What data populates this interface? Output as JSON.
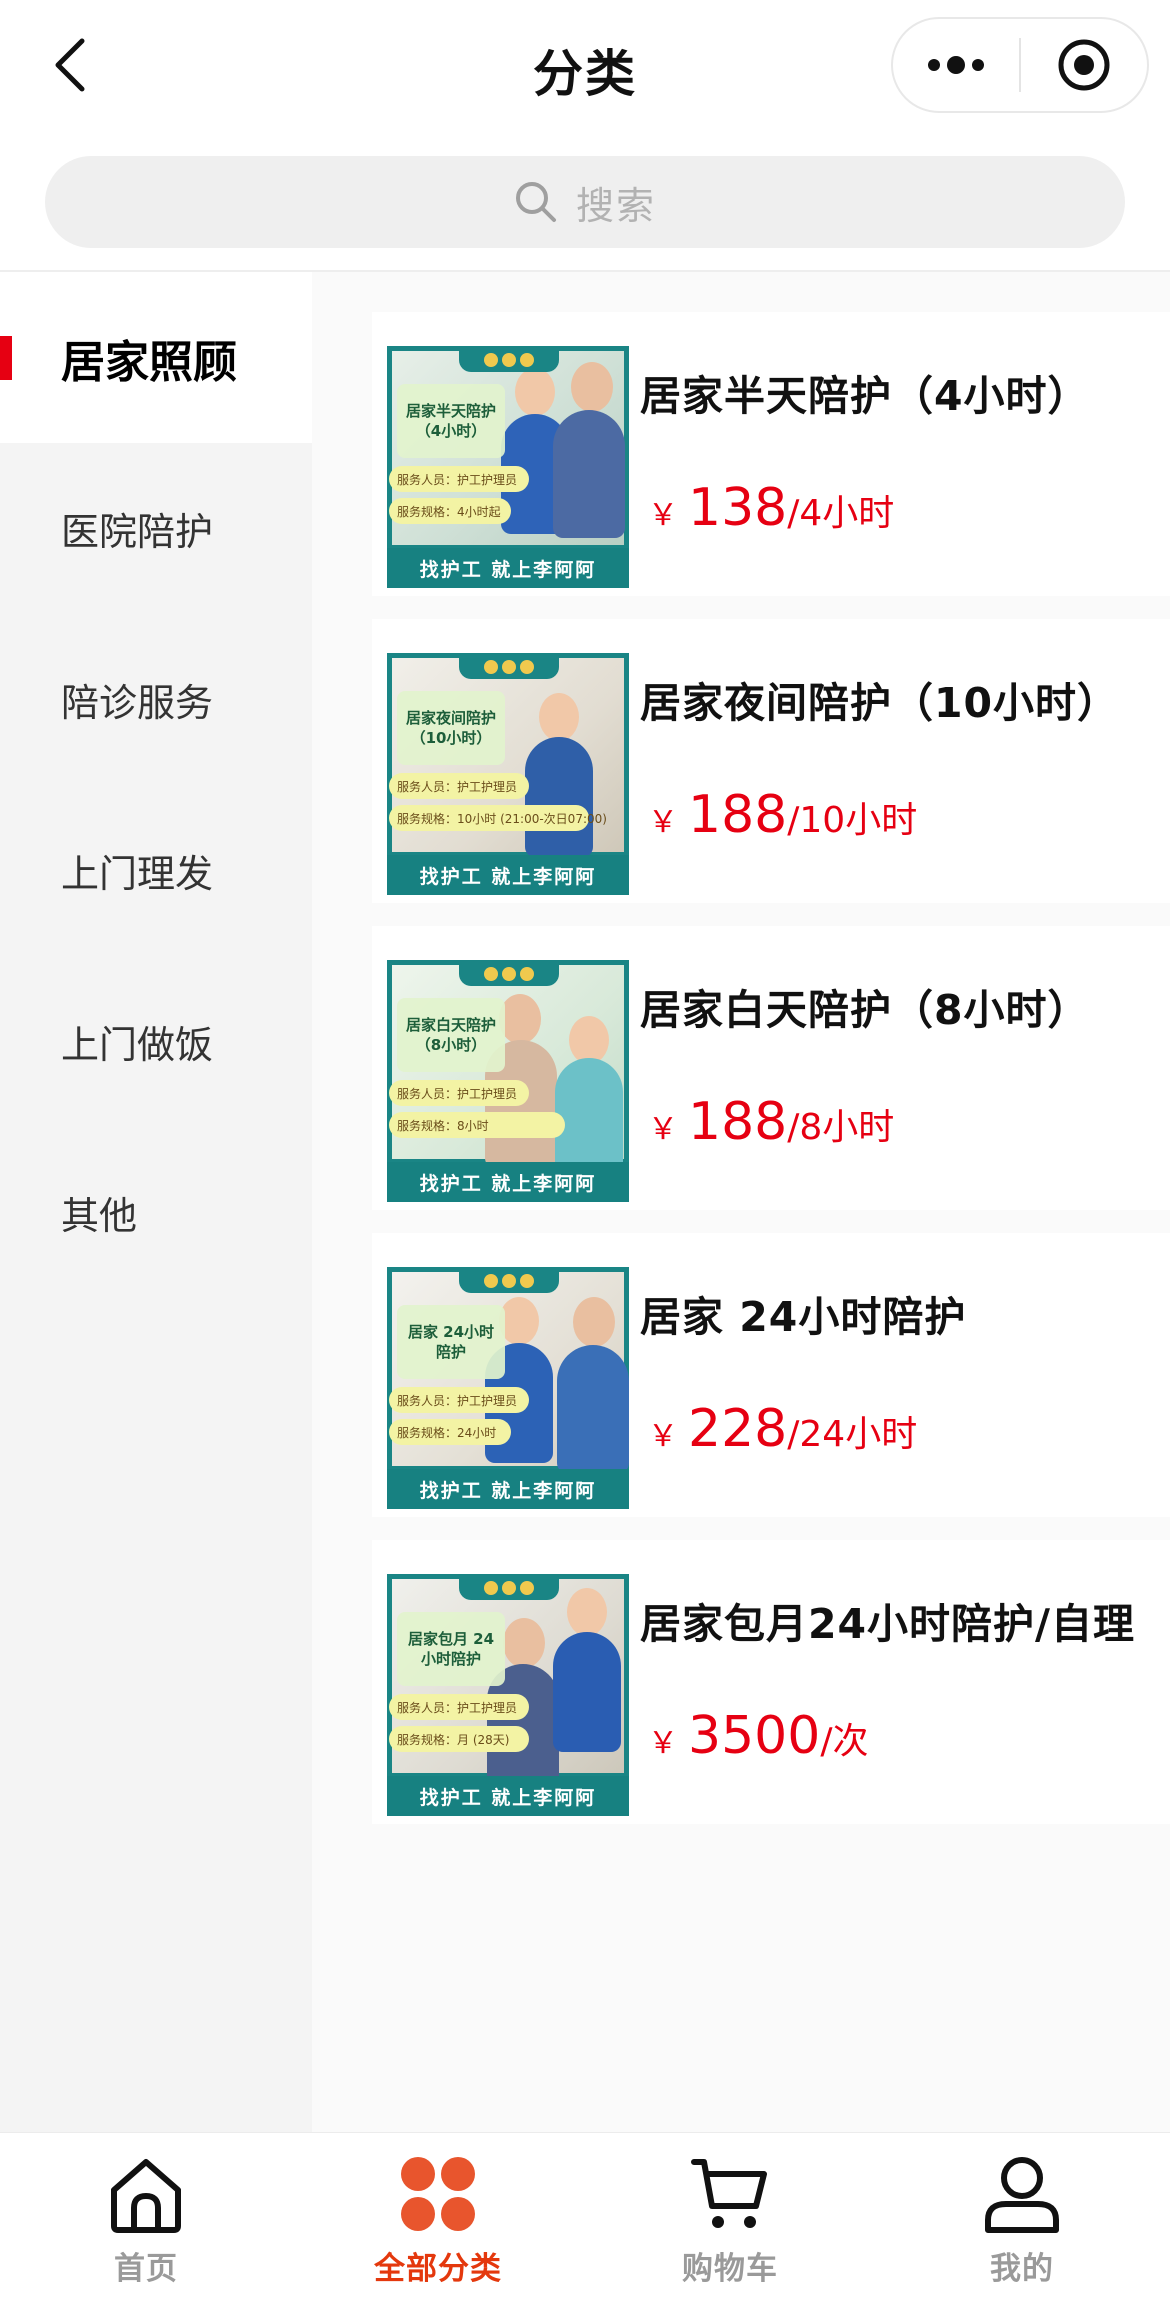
{
  "header": {
    "title": "分类",
    "back_icon": "chevron-left-icon",
    "more_icon": "more-dots-icon",
    "close_icon": "target-circle-icon"
  },
  "search": {
    "placeholder": "搜索",
    "icon": "search-icon"
  },
  "sidebar": {
    "accent_color": "#e60012",
    "items": [
      {
        "label": "居家照顾",
        "active": true
      },
      {
        "label": "医院陪护",
        "active": false
      },
      {
        "label": "陪诊服务",
        "active": false
      },
      {
        "label": "上门理发",
        "active": false
      },
      {
        "label": "上门做饭",
        "active": false
      },
      {
        "label": "其他",
        "active": false
      }
    ]
  },
  "products": [
    {
      "name": "居家半天陪护（4小时）",
      "currency": "￥",
      "price": "138",
      "unit": "/4小时",
      "thumb": {
        "label": "居家半天陪护（4小时）",
        "staff": "服务人员：护工护理员",
        "spec": "服务规格：4小时起",
        "banner": "找护工  就上李阿阿"
      }
    },
    {
      "name": "居家夜间陪护（10小时）",
      "currency": "￥",
      "price": "188",
      "unit": "/10小时",
      "thumb": {
        "label": "居家夜间陪护（10小时）",
        "staff": "服务人员：护工护理员",
        "spec": "服务规格：10小时 (21:00-次日07:00)",
        "banner": "找护工  就上李阿阿"
      }
    },
    {
      "name": "居家白天陪护（8小时）",
      "currency": "￥",
      "price": "188",
      "unit": "/8小时",
      "thumb": {
        "label": "居家白天陪护（8小时）",
        "staff": "服务人员：护工护理员",
        "spec": "服务规格：8小时",
        "banner": "找护工  就上李阿阿"
      }
    },
    {
      "name": "居家 24小时陪护",
      "currency": "￥",
      "price": "228",
      "unit": "/24小时",
      "thumb": {
        "label": "居家 24小时陪护",
        "staff": "服务人员：护工护理员",
        "spec": "服务规格：24小时",
        "banner": "找护工  就上李阿阿"
      }
    },
    {
      "name": "居家包月24小时陪护/自理",
      "currency": "￥",
      "price": "3500",
      "unit": "/次",
      "thumb": {
        "label": "居家包月 24小时陪护",
        "staff": "服务人员：护工护理员",
        "spec": "服务规格：月 (28天)",
        "banner": "找护工  就上李阿阿"
      }
    }
  ],
  "price_color": "#e60012",
  "tabbar": {
    "active_color": "#e4380d",
    "inactive_color": "#9a9a9a",
    "tabs": [
      {
        "label": "首页",
        "icon": "home-icon",
        "active": false
      },
      {
        "label": "全部分类",
        "icon": "category-dots-icon",
        "active": true
      },
      {
        "label": "购物车",
        "icon": "cart-icon",
        "active": false
      },
      {
        "label": "我的",
        "icon": "user-icon",
        "active": false
      }
    ]
  }
}
